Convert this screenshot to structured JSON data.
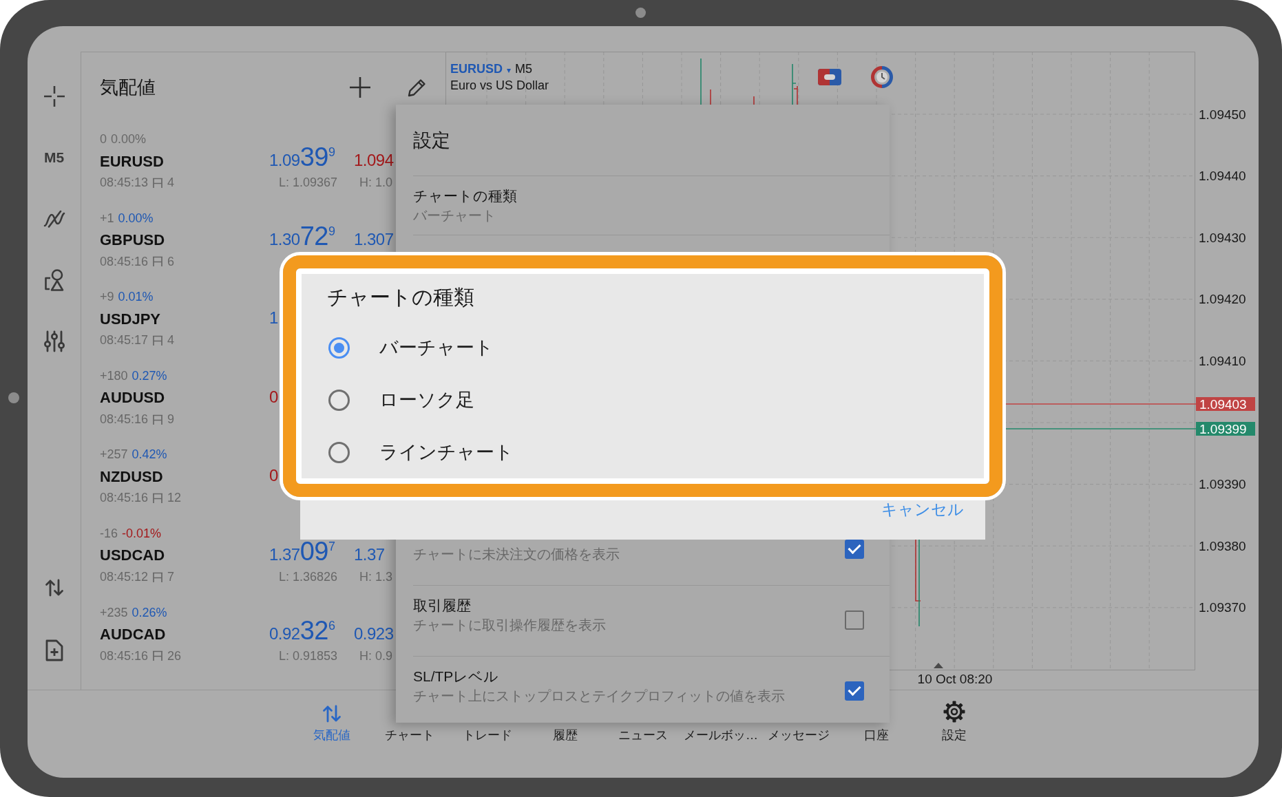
{
  "toolbar": {
    "top_tools": [
      {
        "kind": "crosshair"
      },
      {
        "kind": "timeframe",
        "label": "M5"
      },
      {
        "kind": "indicators"
      },
      {
        "kind": "objects"
      },
      {
        "kind": "chart_settings"
      }
    ],
    "bottom_tools": [
      {
        "kind": "trade"
      },
      {
        "kind": "new_order"
      }
    ]
  },
  "quotes": {
    "title": "気配値",
    "rows": [
      {
        "change": {
          "points": "0",
          "percent": "0.00%",
          "color": "#676767"
        },
        "symbol": "EURUSD",
        "time": "08:45:13",
        "spread": "4",
        "bid": {
          "base": "1.09",
          "pips": "39",
          "point": "9",
          "color": "#1f58b3"
        },
        "ask": {
          "base": "1.094",
          "color": "#a3191b"
        },
        "low": "L: 1.09367",
        "high": "H: 1.0"
      },
      {
        "change": {
          "points": "+1",
          "percent": "0.00%",
          "color": "#1f58b3"
        },
        "symbol": "GBPUSD",
        "time": "08:45:16",
        "spread": "6",
        "bid": {
          "base": "1.30",
          "pips": "72",
          "point": "9",
          "color": "#1f58b3"
        },
        "ask": {
          "base": "1.307",
          "color": "#1f58b3"
        }
      },
      {
        "change": {
          "points": "+9",
          "percent": "0.01%",
          "color": "#1f58b3"
        },
        "symbol": "USDJPY",
        "time": "08:45:17",
        "spread": "4",
        "bid": {
          "base": "1",
          "color": "#1f58b3"
        }
      },
      {
        "change": {
          "points": "+180",
          "percent": "0.27%",
          "color": "#1f58b3"
        },
        "symbol": "AUDUSD",
        "time": "08:45:16",
        "spread": "9",
        "bid": {
          "base": "0",
          "color": "#a3191b"
        }
      },
      {
        "change": {
          "points": "+257",
          "percent": "0.42%",
          "color": "#1f58b3"
        },
        "symbol": "NZDUSD",
        "time": "08:45:16",
        "spread": "12",
        "bid": {
          "base": "0",
          "color": "#a3191b"
        }
      },
      {
        "change": {
          "points": "-16",
          "percent": "-0.01%",
          "color": "#a3191b"
        },
        "symbol": "USDCAD",
        "time": "08:45:12",
        "spread": "7",
        "bid": {
          "base": "1.37",
          "pips": "09",
          "point": "7",
          "color": "#1f58b3"
        },
        "ask": {
          "base": "1.37",
          "color": "#1f58b3"
        },
        "low": "L: 1.36826",
        "high": "H: 1.3"
      },
      {
        "change": {
          "points": "+235",
          "percent": "0.26%",
          "color": "#1f58b3"
        },
        "symbol": "AUDCAD",
        "time": "08:45:16",
        "spread": "26",
        "bid": {
          "base": "0.92",
          "pips": "32",
          "point": "6",
          "color": "#1f58b3"
        },
        "ask": {
          "base": "0.923",
          "color": "#1f58b3"
        },
        "low": "L: 0.91853",
        "high": "H: 0.9"
      }
    ]
  },
  "chart": {
    "symbol": "EURUSD",
    "caret": "▾",
    "timeframe": "M5",
    "description": "Euro vs US Dollar",
    "price_scale": {
      "ticks_above": [
        "1.09450",
        "1.09440",
        "1.09430",
        "1.09420",
        "1.09410"
      ],
      "price_tags": [
        {
          "label": "1.09403",
          "color": "#c04444"
        },
        {
          "label": "1.09399",
          "color": "#24896b"
        }
      ],
      "ticks_below": [
        "1.09390",
        "1.09380",
        "1.09370"
      ]
    },
    "time_label": "10 Oct 08:20"
  },
  "settings": {
    "title": "設定",
    "upper_items": [
      {
        "title": "チャートの種類",
        "value": "バーチャート"
      }
    ],
    "lower_items": [
      {
        "description": "チャートに未決注文の価格を表示",
        "checked": true
      },
      {
        "title": "取引履歴",
        "description": "チャートに取引操作履歴を表示",
        "checked": false
      },
      {
        "title": "SL/TPレベル",
        "description": "チャート上にストップロスとテイクプロフィットの値を表示",
        "checked": true
      }
    ]
  },
  "dialog": {
    "highlighted": true,
    "title": "チャートの種類",
    "options": [
      {
        "label": "バーチャート",
        "selected": true
      },
      {
        "label": "ローソク足",
        "selected": false
      },
      {
        "label": "ラインチャート",
        "selected": false
      }
    ],
    "cancel": "キャンセル"
  },
  "bottom_nav": [
    {
      "kind": "quotes",
      "label": "気配値",
      "selected": true
    },
    {
      "kind": "chart",
      "label": "チャート",
      "selected": false
    },
    {
      "kind": "trade",
      "label": "トレード",
      "selected": false
    },
    {
      "kind": "history",
      "label": "履歴",
      "selected": false
    },
    {
      "kind": "news",
      "label": "ニュース",
      "selected": false
    },
    {
      "kind": "mailbox",
      "label": "メールボッ…",
      "selected": false
    },
    {
      "kind": "messages",
      "label": "メッセージ",
      "selected": false
    },
    {
      "kind": "account",
      "label": "口座",
      "selected": false
    },
    {
      "kind": "settings",
      "label": "設定",
      "selected": false
    }
  ]
}
